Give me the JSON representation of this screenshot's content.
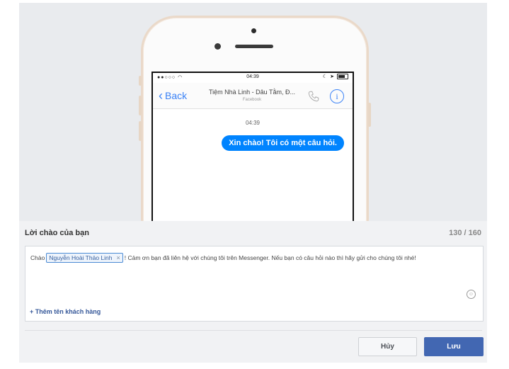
{
  "preview": {
    "status_time": "04:39",
    "back_label": "Back",
    "page_title": "Tiệm Nhà Linh - Dâu Tằm, Đ...",
    "page_subtitle": "Facebook",
    "message_time": "04:39",
    "bubble_text": "Xin chào! Tôi có một câu hỏi.",
    "info_glyph": "i"
  },
  "greeting": {
    "label": "Lời chào của bạn",
    "char_count": "130 / 160",
    "text_prefix": "Chào",
    "name_chip": "Nguyễn Hoài Thảo Linh",
    "chip_close": "×",
    "text_suffix": "! Cảm ơn bạn đã liên hệ với chúng tôi trên Messenger. Nếu bạn có câu hỏi nào thì hãy gửi cho chúng tôi nhé!",
    "add_customer_name": "+ Thêm tên khách hàng"
  },
  "buttons": {
    "cancel": "Hủy",
    "save": "Lưu"
  },
  "colors": {
    "accent": "#4267b2",
    "bubble": "#0084ff",
    "link": "#365899"
  },
  "icons": [
    "back-chevron-icon",
    "phone-icon",
    "info-icon",
    "emoji-icon",
    "wifi-icon",
    "battery-icon",
    "location-icon",
    "moon-icon"
  ]
}
